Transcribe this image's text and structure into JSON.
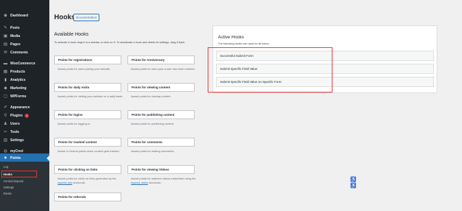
{
  "sidebar": {
    "items": [
      {
        "label": "Dashboard",
        "icon": "dashboard-icon",
        "glyph": "◉"
      },
      {
        "label": "Posts",
        "icon": "pin-icon",
        "glyph": "✎"
      },
      {
        "label": "Media",
        "icon": "media-icon",
        "glyph": "▣"
      },
      {
        "label": "Pages",
        "icon": "pages-icon",
        "glyph": "▤"
      },
      {
        "label": "Comments",
        "icon": "comments-icon",
        "glyph": "✉"
      },
      {
        "label": "WooCommerce",
        "icon": "woocommerce-icon",
        "glyph": "▬"
      },
      {
        "label": "Products",
        "icon": "products-icon",
        "glyph": "▦"
      },
      {
        "label": "Analytics",
        "icon": "analytics-icon",
        "glyph": "▮"
      },
      {
        "label": "Marketing",
        "icon": "marketing-icon",
        "glyph": "◆"
      },
      {
        "label": "WPForms",
        "icon": "wpforms-icon",
        "glyph": "▢"
      },
      {
        "label": "Appearance",
        "icon": "appearance-icon",
        "glyph": "✐"
      },
      {
        "label": "Plugins",
        "icon": "plugins-icon",
        "glyph": "⚲",
        "badge": "1"
      },
      {
        "label": "Users",
        "icon": "users-icon",
        "glyph": "♟"
      },
      {
        "label": "Tools",
        "icon": "tools-icon",
        "glyph": "✂"
      },
      {
        "label": "Settings",
        "icon": "settings-icon",
        "glyph": "▥"
      },
      {
        "label": "myCred",
        "icon": "mycred-icon",
        "glyph": "◍"
      },
      {
        "label": "Points",
        "icon": "star-icon",
        "glyph": "★"
      }
    ],
    "submenu": [
      "Log",
      "Hooks",
      "Central Deposit",
      "Settings",
      "Ranks"
    ]
  },
  "header": {
    "title": "Hooks",
    "doc_button": "Documentation"
  },
  "available": {
    "title": "Available Hooks",
    "description": "To activate a hook drag it to a sidebar or click on it. To deactivate a hook and delete its settings, drag it back.",
    "hooks": [
      {
        "title": "Points for registrations",
        "desc": "Award points for users joining your website."
      },
      {
        "title": "Points for Anniversary",
        "desc": "Award points for each year a user has been member."
      },
      {
        "title": "Points for daily visits",
        "desc": "Award points for visiting your website on a daily basis."
      },
      {
        "title": "Points for viewing content",
        "desc": "Award points for viewing content."
      },
      {
        "title": "Points for logins",
        "desc": "Award points for logging in."
      },
      {
        "title": "Points for publishing content",
        "desc": "Award points for publishing content."
      },
      {
        "title": "Points for trashed content",
        "desc": "Award or Deduct points when content gets trashed."
      },
      {
        "title": "Points for comments",
        "desc": "Award points for making comments."
      },
      {
        "title": "Points for clicking on links",
        "desc_pre": "Award points for clicks on links generated by the ",
        "desc_link": "mycred_link",
        "desc_post": " shortcode."
      },
      {
        "title": "Points for viewing Videos",
        "desc_pre": "Award points for watches videos embedded using the ",
        "desc_link": "mycred_video",
        "desc_post": " shortcode."
      },
      {
        "title": "Points for referrals",
        "desc": ""
      }
    ]
  },
  "active": {
    "title": "Active Hooks",
    "description": "The following hooks are used for all users.",
    "items": [
      "Successful Submit Form",
      "Submit Specific Field Value",
      "Submit Specific Field Value on Specific Form"
    ]
  },
  "colors": {
    "sidebar_bg": "#1d2327",
    "accent": "#2271b1",
    "highlight": "#e33333"
  }
}
